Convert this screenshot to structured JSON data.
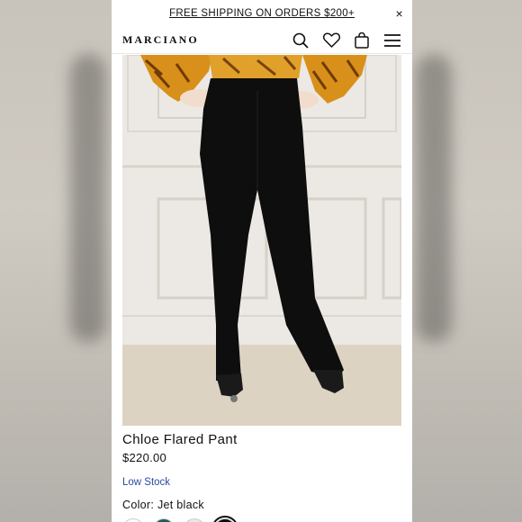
{
  "promo": {
    "text": "FREE SHIPPING ON ORDERS $200+",
    "close_symbol": "×"
  },
  "header": {
    "logo": "MARCIANO",
    "icons": [
      "search-icon",
      "heart-icon",
      "bag-icon",
      "menu-icon"
    ]
  },
  "product": {
    "name": "Chloe Flared Pant",
    "price": "$220.00",
    "stock_status": "Low Stock",
    "color_label": "Color:",
    "color_value": "Jet black",
    "swatches": [
      {
        "color": "#ffffff",
        "selected": false
      },
      {
        "color": "#1f5a5c",
        "selected": false
      },
      {
        "color": "#ece9e2",
        "selected": false
      },
      {
        "color": "#0b0b0b",
        "selected": true
      }
    ]
  },
  "colors": {
    "stock_link": "#2b4aa0",
    "text": "#111111"
  }
}
